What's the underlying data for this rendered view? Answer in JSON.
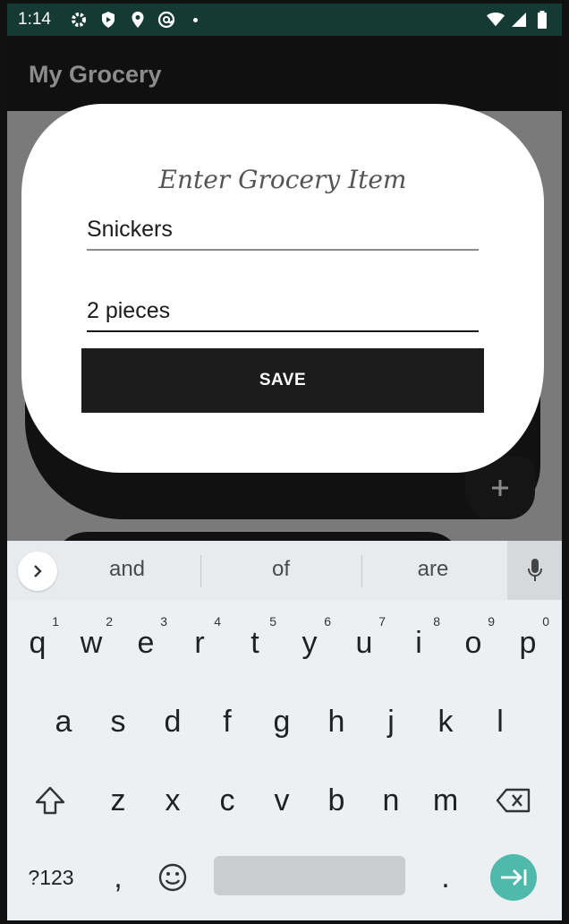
{
  "status_bar": {
    "time": "1:14",
    "icons": [
      "settings-gear-icon",
      "shield-play-icon",
      "location-pin-icon",
      "at-sign-icon",
      "notification-dot-icon",
      "wifi-icon",
      "cell-signal-icon",
      "battery-icon"
    ]
  },
  "app_bar": {
    "title": "My Grocery"
  },
  "background": {
    "fab_label": "+"
  },
  "dialog": {
    "heading": "Enter Grocery Item",
    "item_value": "Snickers",
    "quantity_value": "2 pieces",
    "save_label": "SAVE"
  },
  "keyboard": {
    "suggestions": [
      "and",
      "of",
      "are"
    ],
    "row1": [
      {
        "key": "q",
        "hint": "1"
      },
      {
        "key": "w",
        "hint": "2"
      },
      {
        "key": "e",
        "hint": "3"
      },
      {
        "key": "r",
        "hint": "4"
      },
      {
        "key": "t",
        "hint": "5"
      },
      {
        "key": "y",
        "hint": "6"
      },
      {
        "key": "u",
        "hint": "7"
      },
      {
        "key": "i",
        "hint": "8"
      },
      {
        "key": "o",
        "hint": "9"
      },
      {
        "key": "p",
        "hint": "0"
      }
    ],
    "row2": [
      "a",
      "s",
      "d",
      "f",
      "g",
      "h",
      "j",
      "k",
      "l"
    ],
    "row3": [
      "z",
      "x",
      "c",
      "v",
      "b",
      "n",
      "m"
    ],
    "symbols_label": "?123",
    "comma": ",",
    "period": ".",
    "accent_color": "#4fb9ac"
  }
}
